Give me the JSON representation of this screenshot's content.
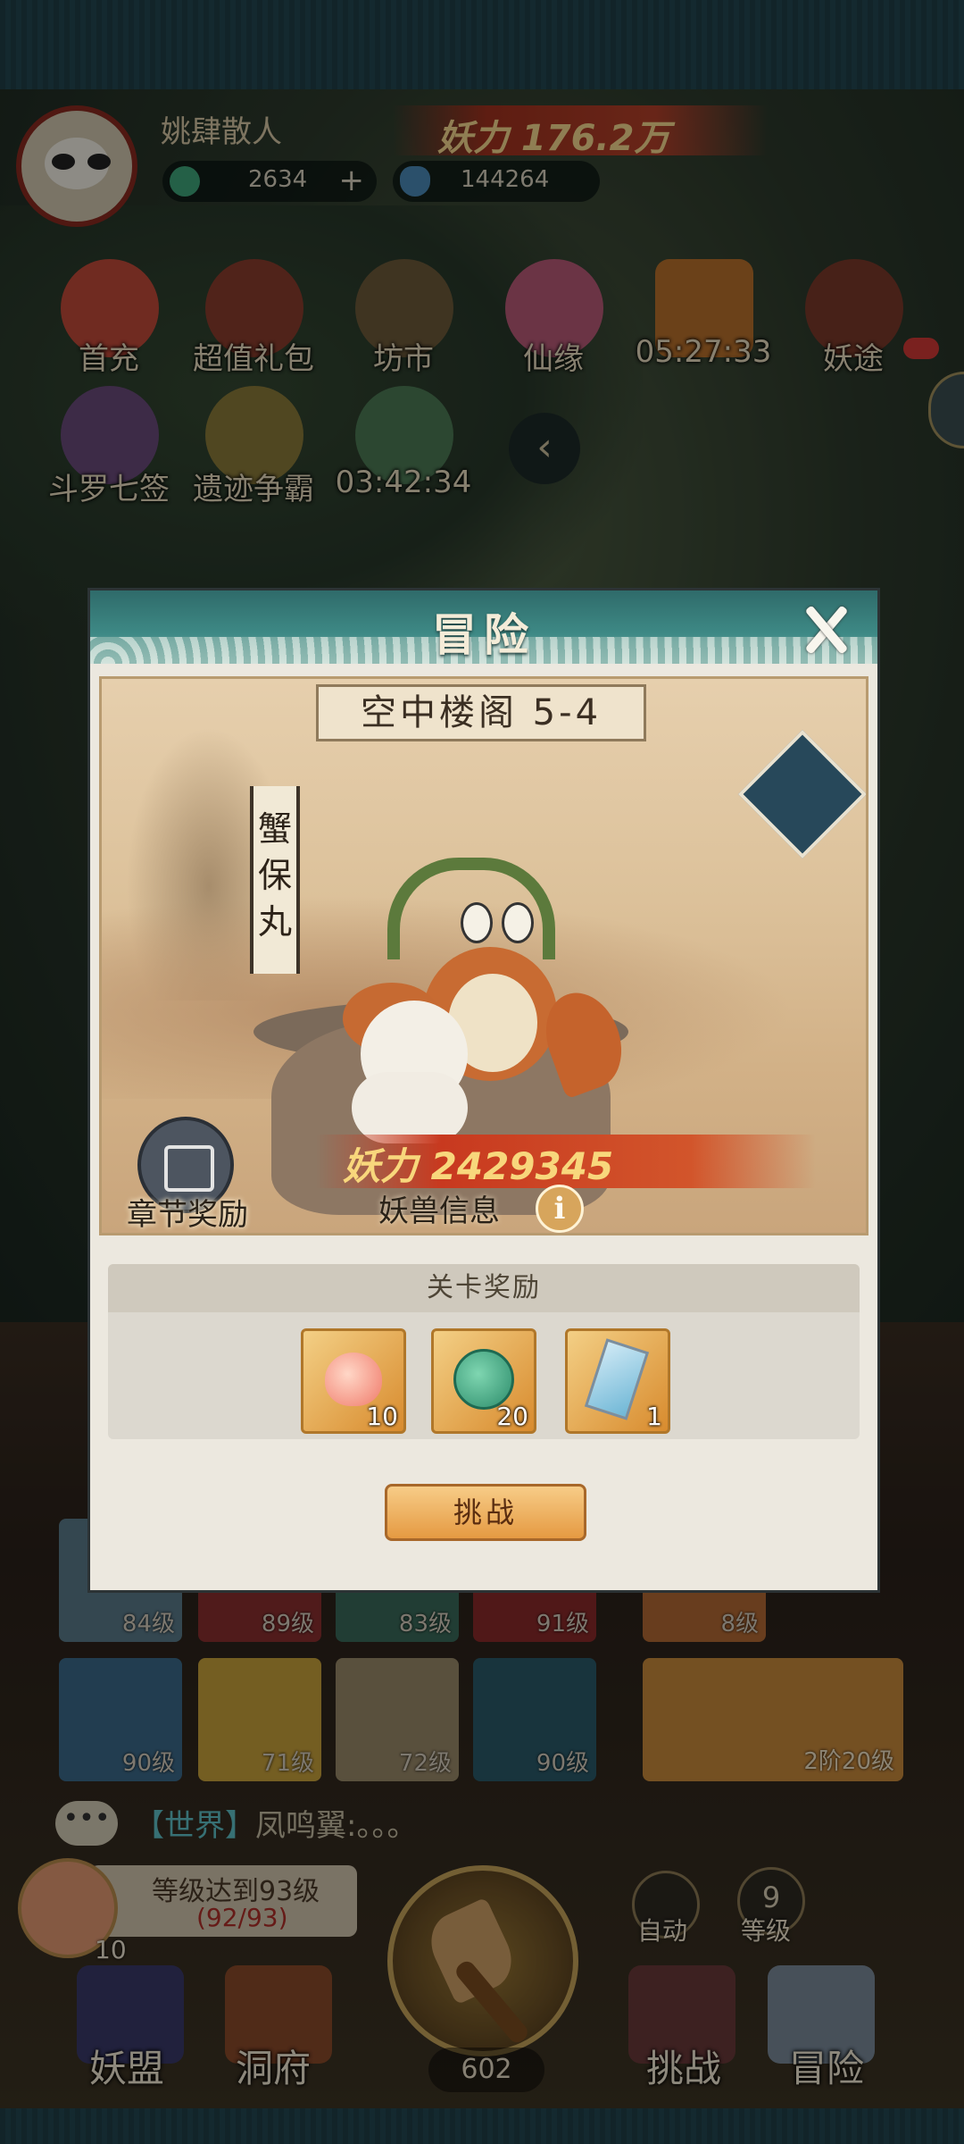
{
  "player": {
    "name": "姚肆散人",
    "power": "妖力 176.2万",
    "jade": "2634",
    "jade_add": "+",
    "crystal": "144264"
  },
  "menu": {
    "row1": [
      {
        "label": "首充",
        "icon": "first-charge-icon"
      },
      {
        "label": "超值礼包",
        "icon": "gift-bag-icon"
      },
      {
        "label": "坊市",
        "icon": "coin-icon"
      },
      {
        "label": "仙缘",
        "icon": "lotus-icon"
      },
      {
        "label": "05:27:33",
        "icon": "giftbox-icon"
      },
      {
        "label": "妖途",
        "icon": "book-icon"
      }
    ],
    "row2": [
      {
        "label": "斗罗七签",
        "icon": "character-icon"
      },
      {
        "label": "遗迹争霸",
        "icon": "ruins-icon"
      },
      {
        "label": "03:42:34",
        "icon": "event-icon"
      }
    ],
    "collapse": "‹"
  },
  "cards": {
    "row1": [
      "84级",
      "89级",
      "83级",
      "91级",
      "8级"
    ],
    "row2": [
      "90级",
      "71级",
      "72级",
      "90级"
    ],
    "wide": "2阶20级"
  },
  "chat": {
    "bubble": "•••",
    "channel": "【世界】",
    "message": "凤鸣翼:。。。"
  },
  "quest": {
    "text": "等级达到93级",
    "progress": "(92/93)",
    "count": "10"
  },
  "hud": {
    "coins": "602",
    "auto_label": "自动",
    "level_num": "9",
    "level_label": "等级"
  },
  "nav": {
    "alliance": "妖盟",
    "cave": "洞府",
    "challenge": "挑战",
    "adventure": "冒险"
  },
  "modal": {
    "title": "冒险",
    "stage_name": "空中楼阁 5-4",
    "boss_name": "蟹保丸",
    "chapter_reward": "章节奖励",
    "power": "妖力 2429345",
    "beast_info": "妖兽信息",
    "info_icon": "i",
    "rewards_title": "关卡奖励",
    "rewards": [
      {
        "icon": "peach-icon",
        "qty": "10"
      },
      {
        "icon": "jade-icon",
        "qty": "20"
      },
      {
        "icon": "ticket-icon",
        "qty": "1"
      }
    ],
    "challenge_button": "挑战"
  },
  "colors": {
    "header_teal": "#3e8a86",
    "button_orange": "#e59a42",
    "power_red": "#c8391f"
  }
}
